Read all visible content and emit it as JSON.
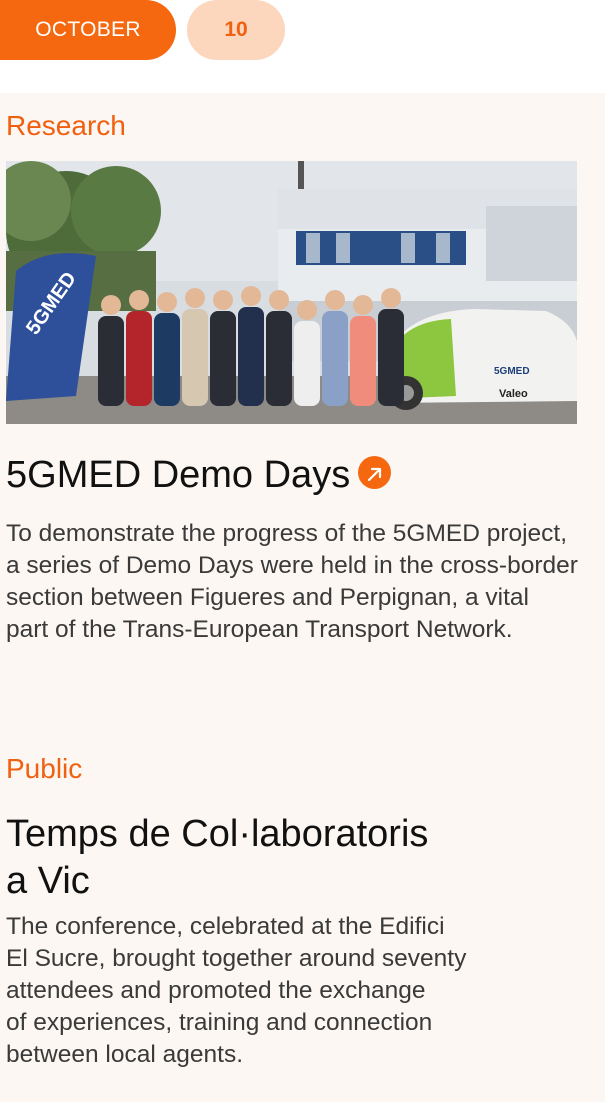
{
  "date": {
    "month": "OCTOBER",
    "day": "10"
  },
  "articles": [
    {
      "category": "Research",
      "title": "5GMED Demo Days",
      "has_link_icon": true,
      "image_desc": "group-photo-5gmed",
      "banner_text": "5GMED",
      "car_text": "5GMED",
      "car_brand": "Valeo",
      "description": "To demonstrate the progress of the 5GMED project, a series of Demo Days were held in the cross-border section between Figueres and Perpignan, a vital part of the Trans-European Transport Network."
    },
    {
      "category": "Public",
      "title_line1": "Temps de Col·laboratoris",
      "title_line2": "a Vic",
      "desc_lines": [
        "The conference, celebrated at the Edifici",
        "El Sucre, brought together around seventy",
        "attendees and promoted the exchange",
        "of experiences, training and connection",
        "between local agents."
      ]
    }
  ],
  "colors": {
    "accent": "#f5680f",
    "accent_light": "#fcd6bd",
    "panel_bg": "#fcf7f2",
    "text": "#111111"
  }
}
